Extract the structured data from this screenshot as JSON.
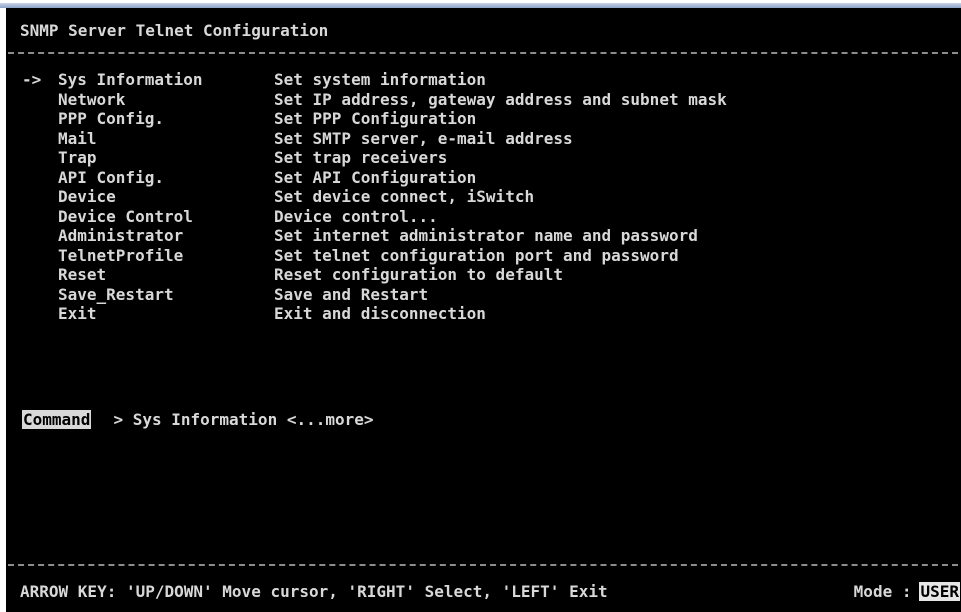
{
  "title": "SNMP Server Telnet Configuration",
  "cursor_glyph": "->",
  "menu": [
    {
      "label": "Sys Information",
      "description": "Set system information",
      "selected": true
    },
    {
      "label": "Network",
      "description": "Set IP address, gateway address and subnet mask",
      "selected": false
    },
    {
      "label": "PPP Config.",
      "description": "Set PPP Configuration",
      "selected": false
    },
    {
      "label": "Mail",
      "description": "Set SMTP server, e-mail address",
      "selected": false
    },
    {
      "label": "Trap",
      "description": "Set trap receivers",
      "selected": false
    },
    {
      "label": "API Config.",
      "description": "Set API Configuration",
      "selected": false
    },
    {
      "label": "Device",
      "description": "Set device connect, iSwitch",
      "selected": false
    },
    {
      "label": "Device Control",
      "description": "Device control...",
      "selected": false
    },
    {
      "label": "Administrator",
      "description": "Set internet administrator name and password",
      "selected": false
    },
    {
      "label": "TelnetProfile",
      "description": "Set telnet configuration port and password",
      "selected": false
    },
    {
      "label": "Reset",
      "description": "Reset configuration to default",
      "selected": false
    },
    {
      "label": "Save_Restart",
      "description": "Save and Restart",
      "selected": false
    },
    {
      "label": "Exit",
      "description": "Exit and disconnection",
      "selected": false
    }
  ],
  "command": {
    "label": "Command",
    "text": "> Sys Information <...more>"
  },
  "status": {
    "hint": "ARROW KEY: 'UP/DOWN' Move cursor, 'RIGHT' Select, 'LEFT' Exit",
    "mode_label": "Mode :",
    "mode_value": "USER"
  },
  "colors": {
    "background": "#000000",
    "foreground": "#d8d8d8",
    "highlight": "#e6e6e6"
  }
}
